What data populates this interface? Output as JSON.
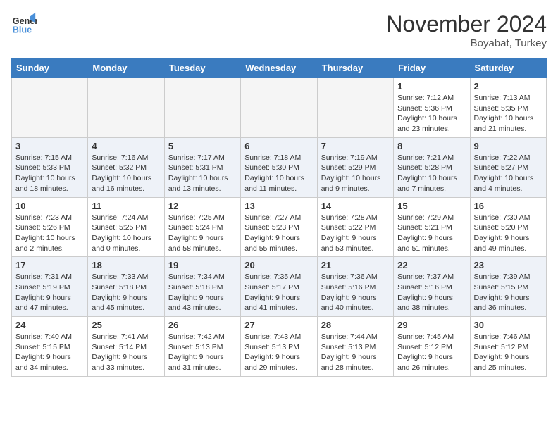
{
  "header": {
    "logo_line1": "General",
    "logo_line2": "Blue",
    "month_title": "November 2024",
    "location": "Boyabat, Turkey"
  },
  "weekdays": [
    "Sunday",
    "Monday",
    "Tuesday",
    "Wednesday",
    "Thursday",
    "Friday",
    "Saturday"
  ],
  "weeks": [
    [
      {
        "day": "",
        "info": ""
      },
      {
        "day": "",
        "info": ""
      },
      {
        "day": "",
        "info": ""
      },
      {
        "day": "",
        "info": ""
      },
      {
        "day": "",
        "info": ""
      },
      {
        "day": "1",
        "info": "Sunrise: 7:12 AM\nSunset: 5:36 PM\nDaylight: 10 hours and 23 minutes."
      },
      {
        "day": "2",
        "info": "Sunrise: 7:13 AM\nSunset: 5:35 PM\nDaylight: 10 hours and 21 minutes."
      }
    ],
    [
      {
        "day": "3",
        "info": "Sunrise: 7:15 AM\nSunset: 5:33 PM\nDaylight: 10 hours and 18 minutes."
      },
      {
        "day": "4",
        "info": "Sunrise: 7:16 AM\nSunset: 5:32 PM\nDaylight: 10 hours and 16 minutes."
      },
      {
        "day": "5",
        "info": "Sunrise: 7:17 AM\nSunset: 5:31 PM\nDaylight: 10 hours and 13 minutes."
      },
      {
        "day": "6",
        "info": "Sunrise: 7:18 AM\nSunset: 5:30 PM\nDaylight: 10 hours and 11 minutes."
      },
      {
        "day": "7",
        "info": "Sunrise: 7:19 AM\nSunset: 5:29 PM\nDaylight: 10 hours and 9 minutes."
      },
      {
        "day": "8",
        "info": "Sunrise: 7:21 AM\nSunset: 5:28 PM\nDaylight: 10 hours and 7 minutes."
      },
      {
        "day": "9",
        "info": "Sunrise: 7:22 AM\nSunset: 5:27 PM\nDaylight: 10 hours and 4 minutes."
      }
    ],
    [
      {
        "day": "10",
        "info": "Sunrise: 7:23 AM\nSunset: 5:26 PM\nDaylight: 10 hours and 2 minutes."
      },
      {
        "day": "11",
        "info": "Sunrise: 7:24 AM\nSunset: 5:25 PM\nDaylight: 10 hours and 0 minutes."
      },
      {
        "day": "12",
        "info": "Sunrise: 7:25 AM\nSunset: 5:24 PM\nDaylight: 9 hours and 58 minutes."
      },
      {
        "day": "13",
        "info": "Sunrise: 7:27 AM\nSunset: 5:23 PM\nDaylight: 9 hours and 55 minutes."
      },
      {
        "day": "14",
        "info": "Sunrise: 7:28 AM\nSunset: 5:22 PM\nDaylight: 9 hours and 53 minutes."
      },
      {
        "day": "15",
        "info": "Sunrise: 7:29 AM\nSunset: 5:21 PM\nDaylight: 9 hours and 51 minutes."
      },
      {
        "day": "16",
        "info": "Sunrise: 7:30 AM\nSunset: 5:20 PM\nDaylight: 9 hours and 49 minutes."
      }
    ],
    [
      {
        "day": "17",
        "info": "Sunrise: 7:31 AM\nSunset: 5:19 PM\nDaylight: 9 hours and 47 minutes."
      },
      {
        "day": "18",
        "info": "Sunrise: 7:33 AM\nSunset: 5:18 PM\nDaylight: 9 hours and 45 minutes."
      },
      {
        "day": "19",
        "info": "Sunrise: 7:34 AM\nSunset: 5:18 PM\nDaylight: 9 hours and 43 minutes."
      },
      {
        "day": "20",
        "info": "Sunrise: 7:35 AM\nSunset: 5:17 PM\nDaylight: 9 hours and 41 minutes."
      },
      {
        "day": "21",
        "info": "Sunrise: 7:36 AM\nSunset: 5:16 PM\nDaylight: 9 hours and 40 minutes."
      },
      {
        "day": "22",
        "info": "Sunrise: 7:37 AM\nSunset: 5:16 PM\nDaylight: 9 hours and 38 minutes."
      },
      {
        "day": "23",
        "info": "Sunrise: 7:39 AM\nSunset: 5:15 PM\nDaylight: 9 hours and 36 minutes."
      }
    ],
    [
      {
        "day": "24",
        "info": "Sunrise: 7:40 AM\nSunset: 5:15 PM\nDaylight: 9 hours and 34 minutes."
      },
      {
        "day": "25",
        "info": "Sunrise: 7:41 AM\nSunset: 5:14 PM\nDaylight: 9 hours and 33 minutes."
      },
      {
        "day": "26",
        "info": "Sunrise: 7:42 AM\nSunset: 5:13 PM\nDaylight: 9 hours and 31 minutes."
      },
      {
        "day": "27",
        "info": "Sunrise: 7:43 AM\nSunset: 5:13 PM\nDaylight: 9 hours and 29 minutes."
      },
      {
        "day": "28",
        "info": "Sunrise: 7:44 AM\nSunset: 5:13 PM\nDaylight: 9 hours and 28 minutes."
      },
      {
        "day": "29",
        "info": "Sunrise: 7:45 AM\nSunset: 5:12 PM\nDaylight: 9 hours and 26 minutes."
      },
      {
        "day": "30",
        "info": "Sunrise: 7:46 AM\nSunset: 5:12 PM\nDaylight: 9 hours and 25 minutes."
      }
    ]
  ]
}
